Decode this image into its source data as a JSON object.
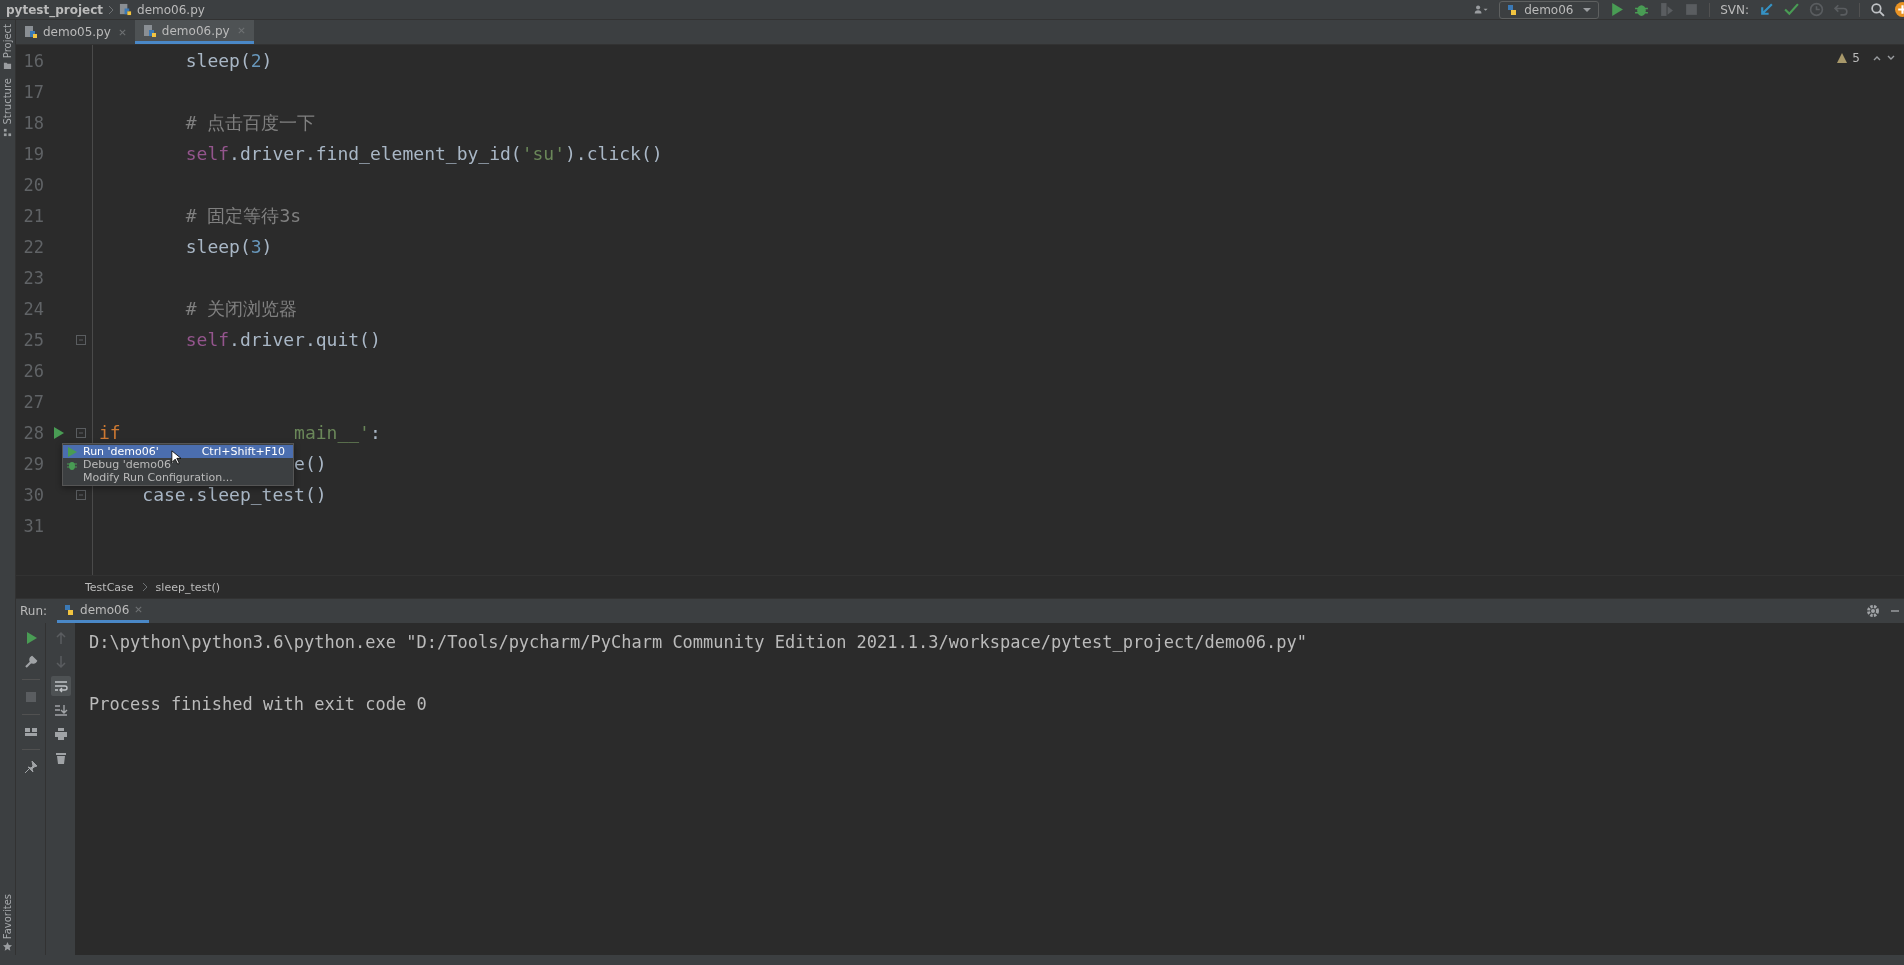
{
  "breadcrumb": [
    {
      "kind": "project",
      "text": "pytest_project"
    },
    {
      "kind": "file",
      "text": "demo06.py"
    }
  ],
  "toolbar": {
    "run_config": "demo06",
    "svn_label": "SVN:"
  },
  "side_tools": {
    "top": [
      "Project",
      "Structure"
    ],
    "bottom": [
      "Favorites"
    ]
  },
  "tabs": [
    {
      "label": "demo05.py",
      "selected": false
    },
    {
      "label": "demo06.py",
      "selected": true
    }
  ],
  "editor": {
    "warning_count": "5",
    "lines": [
      {
        "number": "16",
        "fold": false,
        "run_marker": false,
        "tokens": [
          {
            "kind": "plain",
            "text": "        sleep("
          },
          {
            "kind": "number",
            "text": "2"
          },
          {
            "kind": "plain",
            "text": ")"
          }
        ]
      },
      {
        "number": "17",
        "fold": false,
        "run_marker": false
      },
      {
        "number": "18",
        "fold": false,
        "run_marker": false,
        "tokens": [
          {
            "kind": "comment",
            "text": "        # 点击百度一下"
          }
        ]
      },
      {
        "number": "19",
        "fold": false,
        "run_marker": false,
        "tokens": [
          {
            "kind": "self",
            "text": "        self"
          },
          {
            "kind": "plain",
            "text": ".driver.find_element_by_id("
          },
          {
            "kind": "string",
            "text": "'su'"
          },
          {
            "kind": "plain",
            "text": ").click()"
          }
        ]
      },
      {
        "number": "20",
        "fold": false,
        "run_marker": false
      },
      {
        "number": "21",
        "fold": false,
        "run_marker": false,
        "tokens": [
          {
            "kind": "comment",
            "text": "        # 固定等待3s"
          }
        ]
      },
      {
        "number": "22",
        "fold": false,
        "run_marker": false,
        "tokens": [
          {
            "kind": "plain",
            "text": "        sleep("
          },
          {
            "kind": "number",
            "text": "3"
          },
          {
            "kind": "plain",
            "text": ")"
          }
        ]
      },
      {
        "number": "23",
        "fold": false,
        "run_marker": false
      },
      {
        "number": "24",
        "fold": false,
        "run_marker": false,
        "tokens": [
          {
            "kind": "comment",
            "text": "        # 关闭浏览器"
          }
        ]
      },
      {
        "number": "25",
        "fold": true,
        "run_marker": false,
        "tokens": [
          {
            "kind": "self",
            "text": "        self"
          },
          {
            "kind": "plain",
            "text": ".driver.quit()"
          }
        ]
      },
      {
        "number": "26",
        "fold": false,
        "run_marker": false
      },
      {
        "number": "27",
        "fold": false,
        "run_marker": false
      },
      {
        "number": "28",
        "fold": true,
        "run_marker": true,
        "tokens": [
          {
            "kind": "keyword",
            "text": "if"
          },
          {
            "kind": "string",
            "text": "                main__'"
          },
          {
            "kind": "plain",
            "text": ":"
          }
        ]
      },
      {
        "number": "29",
        "fold": false,
        "run_marker": false,
        "tokens": [
          {
            "kind": "plain",
            "text": "                  e()"
          }
        ]
      },
      {
        "number": "30",
        "fold": true,
        "run_marker": false,
        "tokens": [
          {
            "kind": "plain",
            "text": "    case.sleep_test()"
          }
        ]
      },
      {
        "number": "31",
        "fold": false,
        "run_marker": false
      }
    ],
    "path": [
      "TestCase",
      "sleep_test()"
    ]
  },
  "popup": {
    "items": [
      {
        "kind": "run",
        "label": "Run 'demo06'",
        "shortcut": "Ctrl+Shift+F10",
        "selected": true
      },
      {
        "kind": "debug",
        "label": "Debug 'demo06'",
        "selected": false
      },
      {
        "kind": "plain",
        "label": "Modify Run Configuration...",
        "selected": false
      }
    ]
  },
  "run_panel": {
    "label": "Run:",
    "tabs": [
      {
        "label": "demo06",
        "selected": true
      }
    ],
    "output": [
      "D:\\python\\python3.6\\python.exe \"D:/Tools/pycharm/PyCharm Community Edition 2021.1.3/workspace/pytest_project/demo06.py\"",
      "Process finished with exit code 0"
    ]
  }
}
